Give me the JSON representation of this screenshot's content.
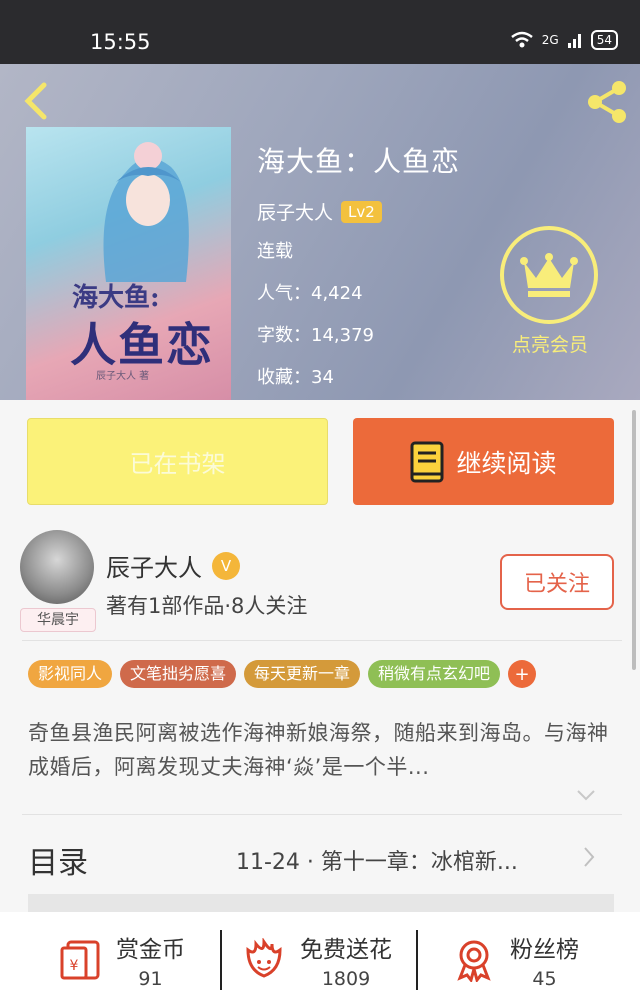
{
  "status_bar": {
    "time": "15:55",
    "network": "2G",
    "battery": "54"
  },
  "book": {
    "title": "海大鱼：人鱼恋",
    "author": "辰子大人",
    "level": "Lv2",
    "status": "连载",
    "popularity": "人气：4,424",
    "word_count": "字数：14,379",
    "favorites": "收藏：34",
    "cover_title_1": "海大鱼:",
    "cover_title_2": "人鱼恋",
    "cover_author": "辰子大人 著"
  },
  "vip": {
    "label": "点亮会员"
  },
  "actions": {
    "shelf_label": "已在书架",
    "read_label": "继续阅读"
  },
  "author_card": {
    "name": "辰子大人",
    "badge": "V",
    "avatar_tag": "华晨宇",
    "description": "著有1部作品·8人关注",
    "follow_label": "已关注"
  },
  "tags": [
    {
      "label": "影视同人",
      "color": "#f0a640"
    },
    {
      "label": "文笔拙劣愿喜",
      "color": "#cf6a4b"
    },
    {
      "label": "每天更新一章",
      "color": "#d49a3a"
    },
    {
      "label": "稍微有点玄幻吧",
      "color": "#8fbf55"
    }
  ],
  "tags_more": "+",
  "synopsis": "奇鱼县渔民阿离被选作海神新娘海祭，随船来到海岛。与海神成婚后，阿离发现丈夫海神‘焱’是一个半...",
  "toc": {
    "label": "目录",
    "latest": "11-24 · 第十一章：冰棺新..."
  },
  "bottom": {
    "reward": {
      "label": "赏金币",
      "count": "91"
    },
    "flower": {
      "label": "免费送花",
      "count": "1809"
    },
    "fans": {
      "label": "粉丝榜",
      "count": "45"
    }
  },
  "colors": {
    "accent": "#ec6a3a",
    "shelf": "#fbf279",
    "vip": "#f8ed7a"
  }
}
